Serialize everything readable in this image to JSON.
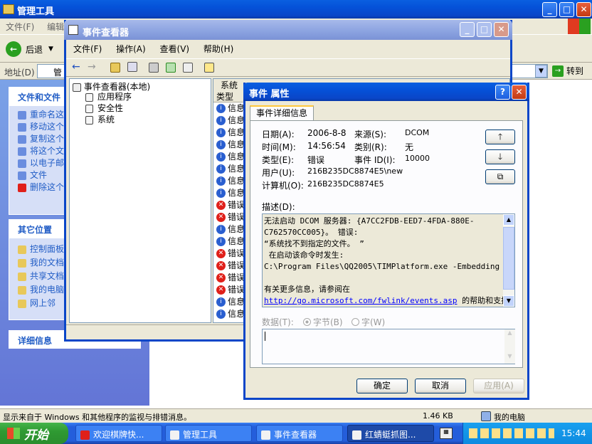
{
  "admin_tools": {
    "title": "管理工具",
    "menu": [
      "文件(F)",
      "编辑"
    ],
    "back_label": "后退",
    "address_label": "地址(D)",
    "address_value": "管",
    "go_label": "转到",
    "file_tasks_title": "文件和文件",
    "file_tasks": [
      "重命名这",
      "移动这个",
      "复制这个",
      "将这个文",
      "以电子邮件",
      "文件",
      "删除这个"
    ],
    "other_places_title": "其它位置",
    "other_places": [
      "控制面板",
      "我的文档",
      "共享文档",
      "我的电脑",
      "网上邻"
    ],
    "details_title": "详细信息"
  },
  "event_viewer": {
    "title": "事件查看器",
    "menu": [
      "文件(F)",
      "操作(A)",
      "查看(V)",
      "帮助(H)"
    ],
    "tree_root": "事件查看器(本地)",
    "tree_items": [
      "应用程序",
      "安全性",
      "系统"
    ],
    "list_header_label": "系统",
    "list_col_type": "类型",
    "rows": [
      "信息",
      "信息",
      "信息",
      "信息",
      "信息",
      "信息",
      "信息",
      "信息",
      "错误",
      "错误",
      "信息",
      "信息",
      "错误",
      "错误",
      "错误",
      "错误",
      "信息",
      "信息"
    ]
  },
  "props": {
    "title": "事件 属性",
    "tab": "事件详细信息",
    "date_label": "日期(A):",
    "date_value": "2006-8-8",
    "source_label": "来源(S):",
    "source_value": "DCOM",
    "time_label": "时间(M):",
    "time_value": "14:56:54",
    "category_label": "类别(R):",
    "category_value": "无",
    "type_label": "类型(E):",
    "type_value": "错误",
    "event_id_label": "事件 ID(I):",
    "event_id_value": "10000",
    "user_label": "用户(U):",
    "user_value": "216B235DC8874E5\\new",
    "computer_label": "计算机(O):",
    "computer_value": "216B235DC8874E5",
    "desc_label": "描述(D):",
    "desc_lines": [
      "无法启动 DCOM 服务器: {A7CC2FDB-EED7-4FDA-880E-",
      "C762570CC005}。 错误:",
      "“系统找不到指定的文件。 ”",
      " 在启动该命令时发生:",
      "C:\\Program Files\\QQ2005\\TIMPlatform.exe -Embedding",
      "",
      "有关更多信息，请参阅在"
    ],
    "desc_link": "http://go.microsoft.com/fwlink/events.asp",
    "desc_after_link": " 的帮助和支持",
    "data_label": "数据(T):",
    "radio_bytes": "字节(B)",
    "radio_words": "字(W)",
    "ok": "确定",
    "cancel": "取消",
    "apply": "应用(A)"
  },
  "statusbar": {
    "text": "显示来自于 Windows 和其他程序的监视与排错消息。",
    "size": "1.46 KB",
    "location": "我的电脑"
  },
  "taskbar": {
    "start": "开始",
    "tasks": [
      "欢迎棋牌快...",
      "管理工具",
      "事件查看器",
      "红蜻蜓抓图..."
    ],
    "time": "15:44"
  },
  "colors": {
    "xp_blue": "#0a5fe0",
    "task_pane": "#6a8ddf",
    "error": "#e0201a",
    "info": "#2a5fd0",
    "link": "#0000ff"
  }
}
